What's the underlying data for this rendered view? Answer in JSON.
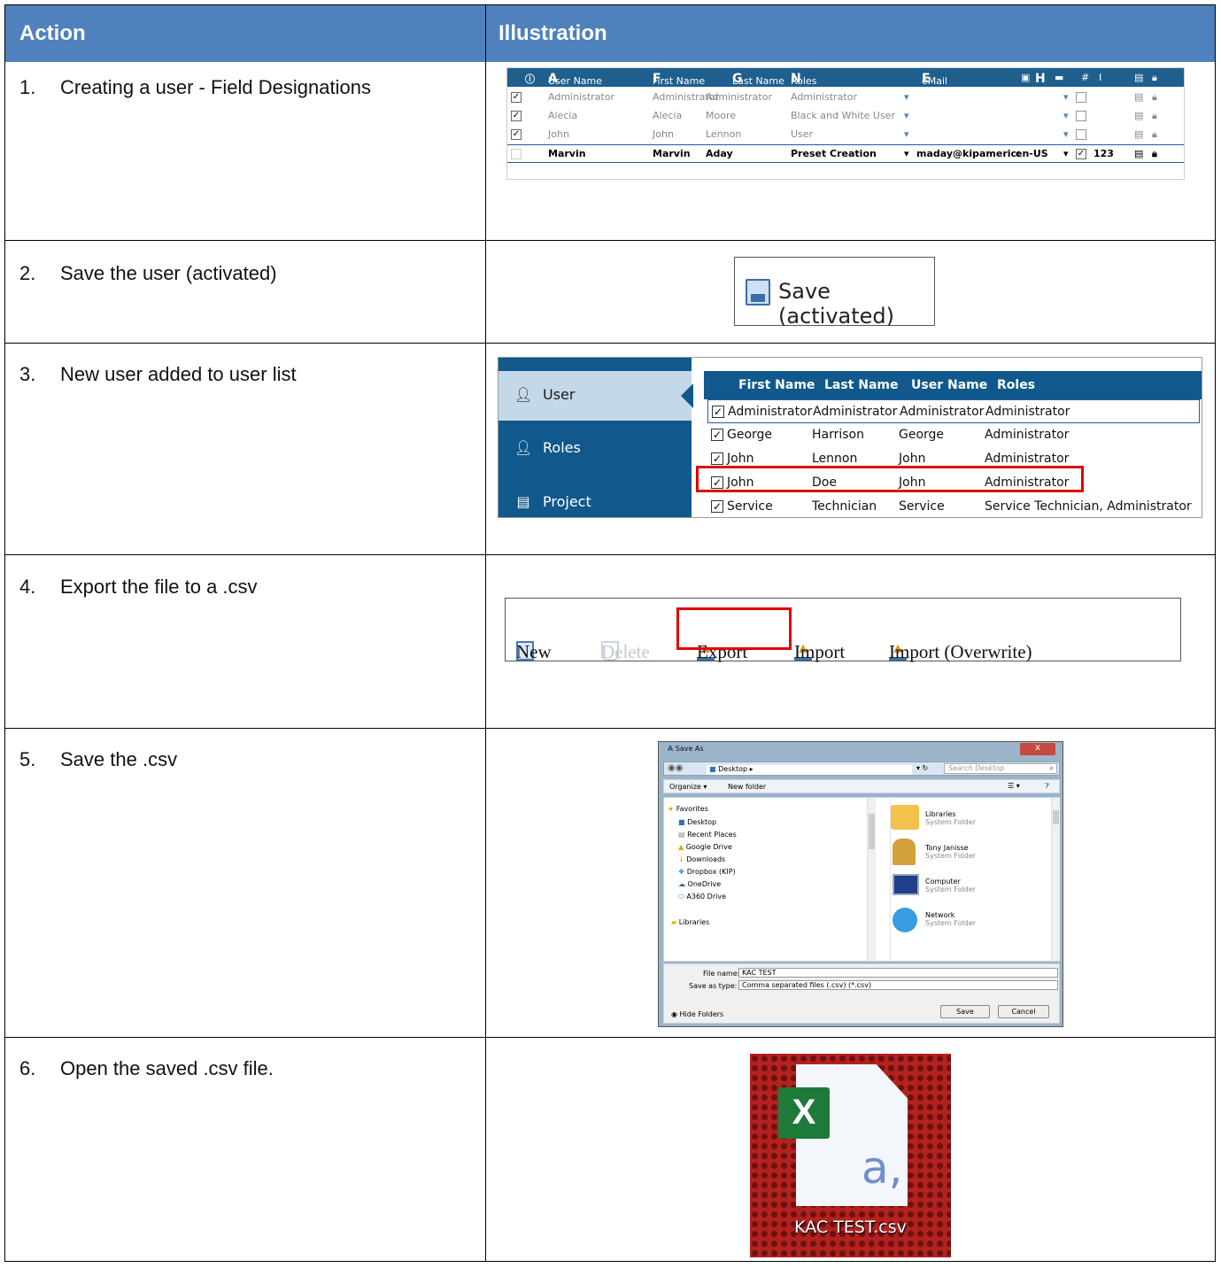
{
  "header": {
    "action": "Action",
    "illustration": "Illustration"
  },
  "steps": [
    {
      "num": "1.",
      "text": "Creating a user - Field Designations"
    },
    {
      "num": "2.",
      "text": "Save the user (activated)"
    },
    {
      "num": "3.",
      "text": "New user added to user list"
    },
    {
      "num": "4.",
      "text": "Export the file to a .csv"
    },
    {
      "num": "5.",
      "text": "Save the .csv"
    },
    {
      "num": "6.",
      "text": "Open the saved .csv file."
    }
  ],
  "user_grid": {
    "headers": {
      "username": "User Name",
      "username_letter": "A",
      "firstname": "First Name",
      "firstname_letter": "F",
      "lastname": "Last Name",
      "lastname_letter": "G",
      "roles": "Roles",
      "roles_letter": "N",
      "email": "eMail",
      "email_letter": "E",
      "h": "H",
      "i": "I"
    },
    "rows": [
      {
        "user": "Administrator",
        "first": "Administrator",
        "last": "Administrator",
        "role": "Administrator",
        "email": "",
        "lang": "",
        "pin": ""
      },
      {
        "user": "Alecia",
        "first": "Alecia",
        "last": "Moore",
        "role": "Black and White User",
        "email": "",
        "lang": "",
        "pin": ""
      },
      {
        "user": "John",
        "first": "John",
        "last": "Lennon",
        "role": "User",
        "email": "",
        "lang": "",
        "pin": ""
      },
      {
        "user": "Marvin",
        "first": "Marvin",
        "last": "Aday",
        "role": "Preset Creation",
        "email": "maday@kipameric:",
        "lang": "en-US",
        "pin": "123"
      }
    ]
  },
  "save_button": {
    "label": "Save (activated)"
  },
  "user_list": {
    "sidebar": [
      "User",
      "Roles",
      "Project"
    ],
    "headers": [
      "First Name",
      "Last Name",
      "User Name",
      "Roles"
    ],
    "rows": [
      [
        "Administrator",
        "Administrator",
        "Administrator",
        "Administrator"
      ],
      [
        "George",
        "Harrison",
        "George",
        "Administrator"
      ],
      [
        "John",
        "Lennon",
        "John",
        "Administrator"
      ],
      [
        "John",
        "Doe",
        "John",
        "Administrator"
      ],
      [
        "Service",
        "Technician",
        "Service",
        "Service Technician, Administrator"
      ]
    ]
  },
  "toolbar": {
    "new": "New",
    "delete": "Delete",
    "export": "Export",
    "import": "Import",
    "import_overwrite": "Import (Overwrite)"
  },
  "save_dialog": {
    "title": "Save As",
    "close": "x",
    "location": "Desktop ▸",
    "search_placeholder": "Search Desktop",
    "organize": "Organize ▾",
    "new_folder": "New folder",
    "nav": [
      "Favorites",
      "Desktop",
      "Recent Places",
      "Google Drive",
      "Downloads",
      "Dropbox (KIP)",
      "OneDrive",
      "A360 Drive",
      "Libraries"
    ],
    "items": [
      {
        "name": "Libraries",
        "type": "System Folder"
      },
      {
        "name": "Tony Janisse",
        "type": "System Folder"
      },
      {
        "name": "Computer",
        "type": "System Folder"
      },
      {
        "name": "Network",
        "type": "System Folder"
      }
    ],
    "file_name_label": "File name:",
    "file_name": "KAC TEST",
    "type_label": "Save as type:",
    "type_value": "Comma separated files (.csv) (*.csv)",
    "hide_folders": "Hide Folders",
    "save": "Save",
    "cancel": "Cancel"
  },
  "csv_file": {
    "name": "KAC TEST.csv",
    "icon_letter": "X",
    "glyph": "a,"
  },
  "colors": {
    "header_bg": "#4f81bd",
    "grid_header": "#1e5f8e",
    "sidebar": "#11598c",
    "highlight": "#e00000"
  }
}
